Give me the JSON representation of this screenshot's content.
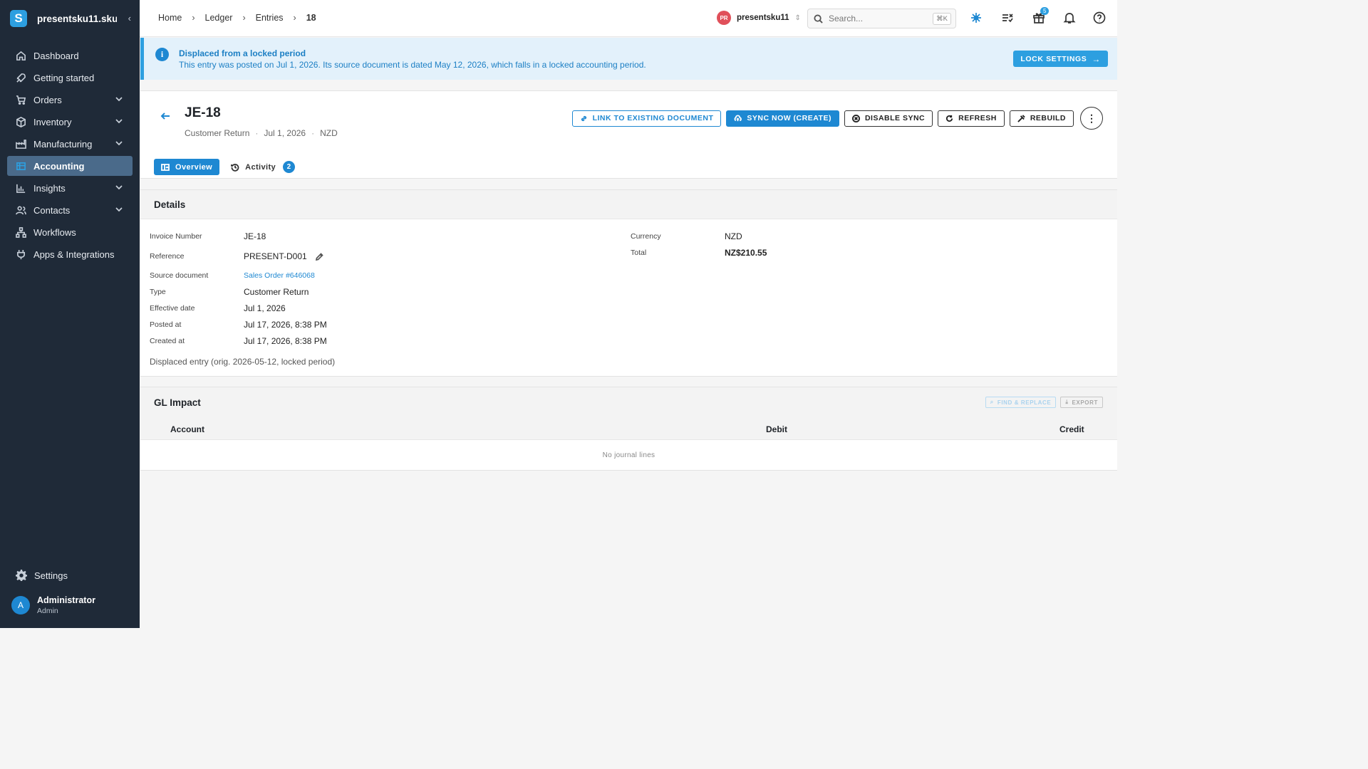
{
  "app": {
    "org_short": "presentsku11.sku...",
    "collapse_glyph": "‹"
  },
  "sidebar": {
    "items": [
      {
        "label": "Dashboard",
        "icon": "home-icon"
      },
      {
        "label": "Getting started",
        "icon": "rocket-icon"
      },
      {
        "label": "Orders",
        "icon": "cart-icon",
        "expandable": true
      },
      {
        "label": "Inventory",
        "icon": "box-icon",
        "expandable": true
      },
      {
        "label": "Manufacturing",
        "icon": "factory-icon",
        "expandable": true
      },
      {
        "label": "Accounting",
        "icon": "ledger-icon",
        "active": true
      },
      {
        "label": "Insights",
        "icon": "bar-chart-icon",
        "expandable": true
      },
      {
        "label": "Contacts",
        "icon": "people-icon",
        "expandable": true
      },
      {
        "label": "Workflows",
        "icon": "workflow-icon"
      },
      {
        "label": "Apps & Integrations",
        "icon": "plug-icon"
      }
    ],
    "settings_label": "Settings",
    "user": {
      "initial": "A",
      "name": "Administrator",
      "role": "Admin"
    }
  },
  "topbar": {
    "breadcrumbs": [
      "Home",
      "Ledger",
      "Entries",
      "18"
    ],
    "org_badge": "PR",
    "org_name": "presentsku11",
    "search_placeholder": "Search...",
    "search_shortcut": "⌘K",
    "gift_count": "5"
  },
  "banner": {
    "title": "Displaced from a locked period",
    "text": "This entry was posted on Jul 1, 2026. Its source document is dated May 12, 2026, which falls in a locked accounting period.",
    "button": "LOCK SETTINGS"
  },
  "entry": {
    "title": "JE-18",
    "subtitle_type": "Customer Return",
    "subtitle_date": "Jul 1, 2026",
    "subtitle_currency": "NZD",
    "actions": {
      "link": "LINK TO EXISTING DOCUMENT",
      "sync": "SYNC NOW (CREATE)",
      "disable": "DISABLE SYNC",
      "refresh": "REFRESH",
      "rebuild": "REBUILD"
    },
    "tabs": {
      "overview": "Overview",
      "activity": "Activity",
      "activity_count": "2"
    }
  },
  "details": {
    "heading": "Details",
    "left": [
      {
        "key": "Invoice Number",
        "value": "JE-18"
      },
      {
        "key": "Reference",
        "value": "PRESENT-D001"
      },
      {
        "key": "Source document",
        "value": "Sales Order #646068"
      },
      {
        "key": "Type",
        "value": "Customer Return"
      },
      {
        "key": "Effective date",
        "value": "Jul 1, 2026"
      },
      {
        "key": "Posted at",
        "value": "Jul 17, 2026, 8:38 PM"
      },
      {
        "key": "Created at",
        "value": "Jul 17, 2026, 8:38 PM"
      }
    ],
    "right": [
      {
        "key": "Currency",
        "value": "NZD"
      },
      {
        "key": "Total",
        "value": "NZ$210.55"
      }
    ],
    "note": "Displaced entry (orig. 2026-05-12, locked period)"
  },
  "gl": {
    "heading": "GL Impact",
    "find_replace": "FIND & REPLACE",
    "export": "EXPORT",
    "columns": {
      "account": "Account",
      "debit": "Debit",
      "credit": "Credit"
    },
    "empty": "No journal lines"
  },
  "colors": {
    "accent": "#1e88d2",
    "sidebar": "#1f2a38",
    "banner_bg": "#e3f1fb",
    "org_badge": "#e0505a"
  }
}
